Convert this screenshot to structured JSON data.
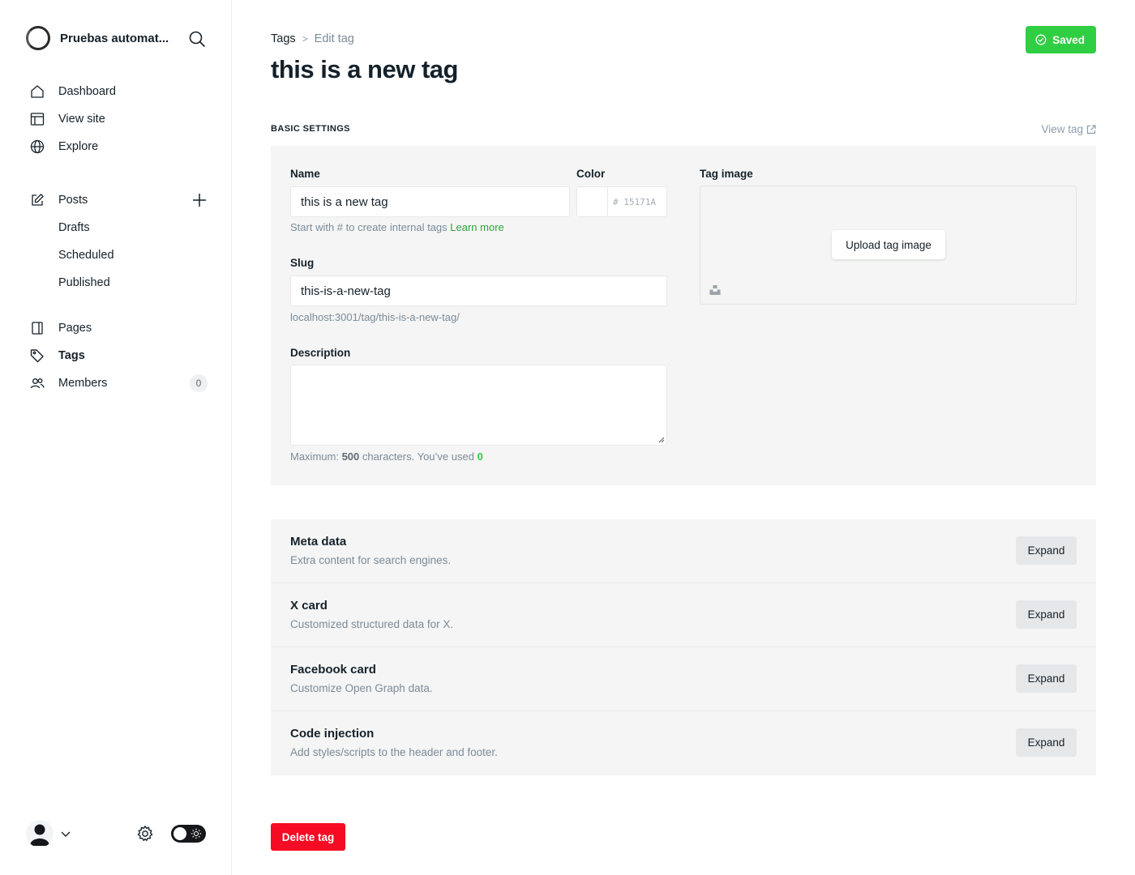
{
  "sidebar": {
    "site_name": "Pruebas automat...",
    "nav_primary": [
      {
        "label": "Dashboard",
        "icon": "home-icon"
      },
      {
        "label": "View site",
        "icon": "layout-icon"
      },
      {
        "label": "Explore",
        "icon": "globe-icon"
      }
    ],
    "posts": {
      "label": "Posts",
      "icon": "edit-icon",
      "sub": [
        "Drafts",
        "Scheduled",
        "Published"
      ]
    },
    "nav_secondary": [
      {
        "label": "Pages",
        "icon": "pages-icon"
      },
      {
        "label": "Tags",
        "icon": "tag-icon",
        "active": true
      },
      {
        "label": "Members",
        "icon": "members-icon",
        "count": "0"
      }
    ]
  },
  "header": {
    "breadcrumb_parent": "Tags",
    "breadcrumb_current": "Edit tag",
    "title": "this is a new tag",
    "saved_label": "Saved"
  },
  "basic_settings": {
    "section_label": "BASIC SETTINGS",
    "view_tag_label": "View tag",
    "name_label": "Name",
    "name_value": "this is a new tag",
    "name_hint": "Start with # to create internal tags",
    "name_hint_link": "Learn more",
    "color_label": "Color",
    "color_hex_placeholder": "# 15171A",
    "slug_label": "Slug",
    "slug_value": "this-is-a-new-tag",
    "slug_url": "localhost:3001/tag/this-is-a-new-tag/",
    "description_label": "Description",
    "desc_hint_prefix": "Maximum:",
    "desc_max": "500",
    "desc_hint_middle": "characters. You’ve used",
    "desc_used": "0",
    "tag_image_label": "Tag image",
    "upload_label": "Upload tag image"
  },
  "collapsibles": [
    {
      "title": "Meta data",
      "desc": "Extra content for search engines.",
      "button": "Expand"
    },
    {
      "title": "X card",
      "desc": "Customized structured data for X.",
      "button": "Expand"
    },
    {
      "title": "Facebook card",
      "desc": "Customize Open Graph data.",
      "button": "Expand"
    },
    {
      "title": "Code injection",
      "desc": "Add styles/scripts to the header and footer.",
      "button": "Expand"
    }
  ],
  "delete_label": "Delete tag",
  "colors": {
    "accent_green": "#30cf43",
    "danger_red": "#f50b23",
    "panel_bg": "#f4f5f4"
  }
}
